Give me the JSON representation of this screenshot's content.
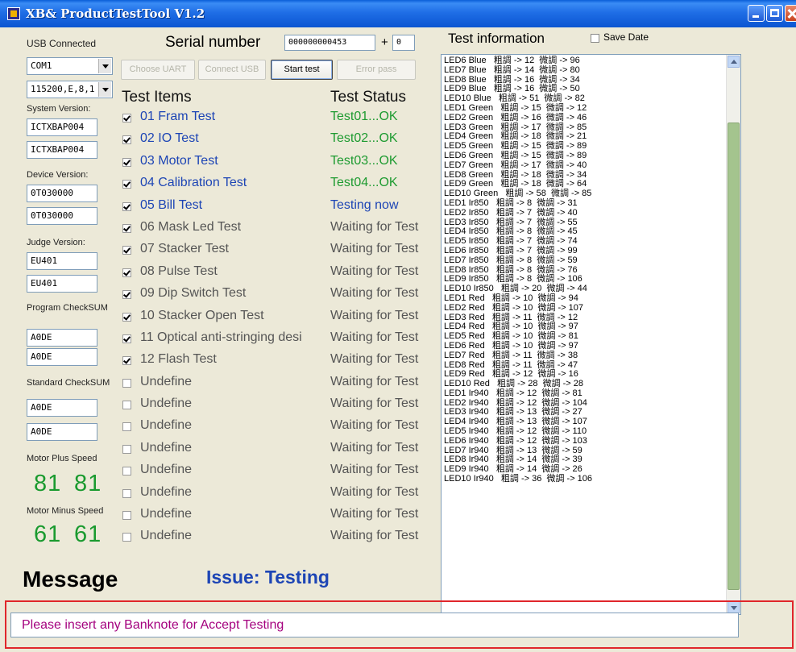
{
  "window": {
    "title": "XB& ProductTestTool V1.2"
  },
  "left_panel": {
    "usb_status": "USB Connected",
    "port_select": "COM1",
    "baud_select": "115200,E,8,1",
    "system_version_label": "System Version:",
    "system_version_1": "ICTXBAP004",
    "system_version_2": "ICTXBAP004",
    "device_version_label": "Device Version:",
    "device_version_1": "0T030000",
    "device_version_2": "0T030000",
    "judge_version_label": "Judge Version:",
    "judge_version_1": "EU401",
    "judge_version_2": "EU401",
    "program_checksum_label": "Program CheckSUM",
    "program_checksum_1": "A0DE",
    "program_checksum_2": "A0DE",
    "standard_checksum_label": "Standard CheckSUM",
    "standard_checksum_1": "A0DE",
    "standard_checksum_2": "A0DE",
    "motor_plus_label": "Motor Plus Speed",
    "motor_plus_1": "81",
    "motor_plus_2": "81",
    "motor_minus_label": "Motor Minus Speed",
    "motor_minus_1": "61",
    "motor_minus_2": "61"
  },
  "header": {
    "serial_label": "Serial number",
    "serial_value": "000000000453",
    "plus_label": "+",
    "plus_value": "0"
  },
  "toolbar": {
    "choose_uart": "Choose UART",
    "connect_usb": "Connect USB",
    "start_test": "Start test",
    "error_pass": "Error pass"
  },
  "tests": {
    "items_header": "Test Items",
    "status_header": "Test Status",
    "colors": {
      "blue": "#1d45b5",
      "green": "#1e9b31",
      "gray": "#555555"
    },
    "rows": [
      {
        "label": "01 Fram Test",
        "status": "Test01...OK",
        "checked": true,
        "state": "ok"
      },
      {
        "label": "02 IO Test",
        "status": "Test02...OK",
        "checked": true,
        "state": "ok"
      },
      {
        "label": "03 Motor Test",
        "status": "Test03...OK",
        "checked": true,
        "state": "ok"
      },
      {
        "label": "04 Calibration Test",
        "status": "Test04...OK",
        "checked": true,
        "state": "ok"
      },
      {
        "label": "05 Bill Test",
        "status": "Testing now",
        "checked": true,
        "state": "testing"
      },
      {
        "label": "06 Mask Led Test",
        "status": "Waiting for Test",
        "checked": true,
        "state": "waiting"
      },
      {
        "label": "07 Stacker Test",
        "status": "Waiting for Test",
        "checked": true,
        "state": "waiting"
      },
      {
        "label": "08 Pulse Test",
        "status": "Waiting for Test",
        "checked": true,
        "state": "waiting"
      },
      {
        "label": "09 Dip Switch Test",
        "status": "Waiting for Test",
        "checked": true,
        "state": "waiting"
      },
      {
        "label": "10 Stacker Open Test",
        "status": "Waiting for Test",
        "checked": true,
        "state": "waiting"
      },
      {
        "label": "11 Optical anti-stringing desi",
        "status": "Waiting for Test",
        "checked": true,
        "state": "waiting"
      },
      {
        "label": "12 Flash Test",
        "status": "Waiting for Test",
        "checked": true,
        "state": "waiting"
      },
      {
        "label": "Undefine",
        "status": "Waiting for Test",
        "checked": false,
        "state": "waiting"
      },
      {
        "label": "Undefine",
        "status": "Waiting for Test",
        "checked": false,
        "state": "waiting"
      },
      {
        "label": "Undefine",
        "status": "Waiting for Test",
        "checked": false,
        "state": "waiting"
      },
      {
        "label": "Undefine",
        "status": "Waiting for Test",
        "checked": false,
        "state": "waiting"
      },
      {
        "label": "Undefine",
        "status": "Waiting for Test",
        "checked": false,
        "state": "waiting"
      },
      {
        "label": "Undefine",
        "status": "Waiting for Test",
        "checked": false,
        "state": "waiting"
      },
      {
        "label": "Undefine",
        "status": "Waiting for Test",
        "checked": false,
        "state": "waiting"
      },
      {
        "label": "Undefine",
        "status": "Waiting for Test",
        "checked": false,
        "state": "waiting"
      }
    ]
  },
  "message": {
    "heading": "Message",
    "issue": "Issue: Testing",
    "text": "Please insert any Banknote for Accept Testing"
  },
  "info": {
    "heading": "Test information",
    "save_date_label": "Save Date",
    "log_lines": [
      "LED6 Blue   粗調 -> 12  微調 -> 96",
      "LED7 Blue   粗調 -> 14  微調 -> 80",
      "LED8 Blue   粗調 -> 16  微調 -> 34",
      "LED9 Blue   粗調 -> 16  微調 -> 50",
      "LED10 Blue   粗調 -> 51  微調 -> 82",
      "LED1 Green   粗調 -> 15  微調 -> 12",
      "LED2 Green   粗調 -> 16  微調 -> 46",
      "LED3 Green   粗調 -> 17  微調 -> 85",
      "LED4 Green   粗調 -> 18  微調 -> 21",
      "LED5 Green   粗調 -> 15  微調 -> 89",
      "LED6 Green   粗調 -> 15  微調 -> 89",
      "LED7 Green   粗調 -> 17  微調 -> 40",
      "LED8 Green   粗調 -> 18  微調 -> 34",
      "LED9 Green   粗調 -> 18  微調 -> 64",
      "LED10 Green   粗調 -> 58  微調 -> 85",
      "LED1 Ir850   粗調 -> 8  微調 -> 31",
      "LED2 Ir850   粗調 -> 7  微調 -> 40",
      "LED3 Ir850   粗調 -> 7  微調 -> 55",
      "LED4 Ir850   粗調 -> 8  微調 -> 45",
      "LED5 Ir850   粗調 -> 7  微調 -> 74",
      "LED6 Ir850   粗調 -> 7  微調 -> 99",
      "LED7 Ir850   粗調 -> 8  微調 -> 59",
      "LED8 Ir850   粗調 -> 8  微調 -> 76",
      "LED9 Ir850   粗調 -> 8  微調 -> 106",
      "LED10 Ir850   粗調 -> 20  微調 -> 44",
      "LED1 Red   粗調 -> 10  微調 -> 94",
      "LED2 Red   粗調 -> 10  微調 -> 107",
      "LED3 Red   粗調 -> 11  微調 -> 12",
      "LED4 Red   粗調 -> 10  微調 -> 97",
      "LED5 Red   粗調 -> 10  微調 -> 81",
      "LED6 Red   粗調 -> 10  微調 -> 97",
      "LED7 Red   粗調 -> 11  微調 -> 38",
      "LED8 Red   粗調 -> 11  微調 -> 47",
      "LED9 Red   粗調 -> 12  微調 -> 16",
      "LED10 Red   粗調 -> 28  微調 -> 28",
      "LED1 Ir940   粗調 -> 12  微調 -> 81",
      "LED2 Ir940   粗調 -> 12  微調 -> 104",
      "LED3 Ir940   粗調 -> 13  微調 -> 27",
      "LED4 Ir940   粗調 -> 13  微調 -> 107",
      "LED5 Ir940   粗調 -> 12  微調 -> 110",
      "LED6 Ir940   粗調 -> 12  微調 -> 103",
      "LED7 Ir940   粗調 -> 13  微調 -> 59",
      "LED8 Ir940   粗調 -> 14  微調 -> 39",
      "LED9 Ir940   粗調 -> 14  微調 -> 26",
      "LED10 Ir940   粗調 -> 36  微調 -> 106"
    ]
  }
}
